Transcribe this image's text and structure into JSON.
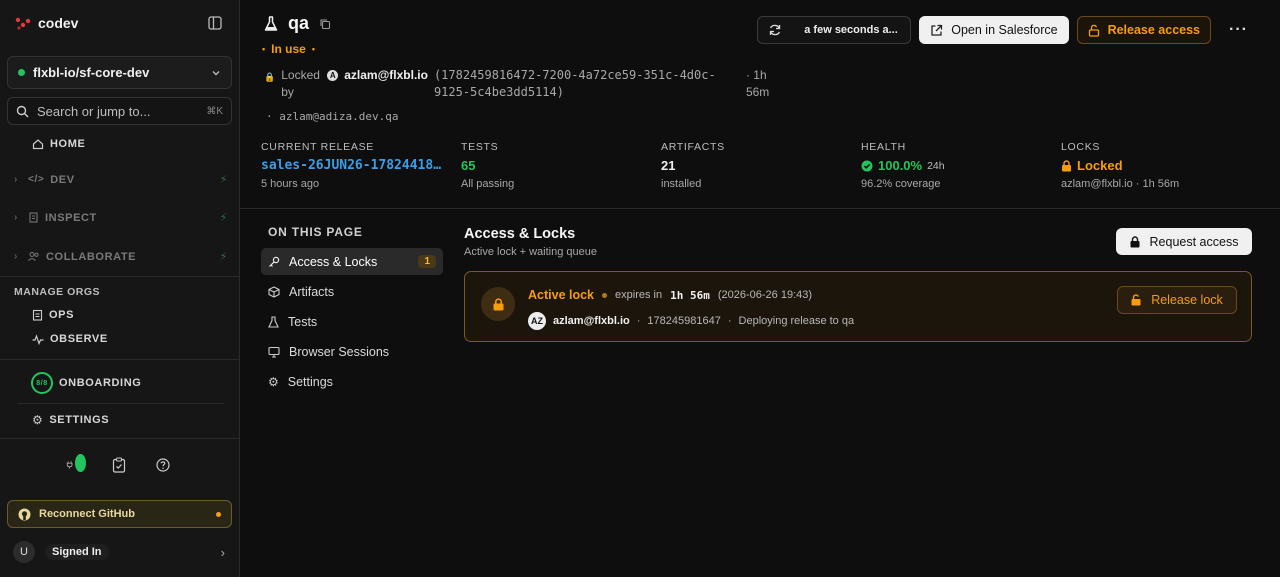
{
  "sidebar": {
    "brand": "codev",
    "org": "flxbl-io/sf-core-dev",
    "search_placeholder": "Search or jump to...",
    "search_shortcut": "⌘K",
    "nav": {
      "home": "HOME",
      "dev": "DEV",
      "inspect": "INSPECT",
      "collaborate": "COLLABORATE"
    },
    "manage_label": "MANAGE ORGS",
    "manage": {
      "ops": "OPS",
      "observe": "OBSERVE"
    },
    "onboarding": {
      "label": "ONBOARDING",
      "progress": "8/8"
    },
    "settings": "SETTINGS",
    "github_button": "Reconnect GitHub",
    "user": {
      "initial": "U",
      "status": "Signed In"
    }
  },
  "header": {
    "title": "qa",
    "status": "In use",
    "locked_by_label": "Locked by",
    "locked_by_initial": "A",
    "locked_by_user": "azlam@flxbl.io",
    "lock_id": "(1782459816472-7200-4a72ce59-351c-4d0c-9125-5c4be3dd5114)",
    "lock_duration": "· 1h 56m",
    "lock_email": "· azlam@adiza.dev.qa"
  },
  "actions": {
    "refresh_label": "a few seconds a...",
    "open_salesforce": "Open in Salesforce",
    "release_access": "Release access",
    "more": "···"
  },
  "stats": {
    "release": {
      "label": "CURRENT RELEASE",
      "value": "sales-26JUN26-17824418...",
      "sub": "5 hours ago"
    },
    "tests": {
      "label": "TESTS",
      "value": "65",
      "sub": "All passing"
    },
    "artifacts": {
      "label": "ARTIFACTS",
      "value": "21",
      "sub": "installed"
    },
    "health": {
      "label": "HEALTH",
      "value": "100.0%",
      "window": "24h",
      "sub": "96.2% coverage"
    },
    "locks": {
      "label": "LOCKS",
      "value": "Locked",
      "sub": "azlam@flxbl.io · 1h 56m"
    }
  },
  "toc": {
    "title": "ON THIS PAGE",
    "items": [
      {
        "label": "Access & Locks",
        "count": "1"
      },
      {
        "label": "Artifacts"
      },
      {
        "label": "Tests"
      },
      {
        "label": "Browser Sessions"
      },
      {
        "label": "Settings"
      }
    ]
  },
  "section": {
    "title": "Access & Locks",
    "subtitle": "Active lock + waiting queue",
    "request_button": "Request access"
  },
  "lock_card": {
    "status": "Active lock",
    "expires_label": "expires in",
    "expires_in": "1h 56m",
    "expires_at": "(2026-06-26 19:43)",
    "user_initials": "AZ",
    "user": "azlam@flxbl.io",
    "sep": "·",
    "id": "178245981647",
    "note": "Deploying release to qa",
    "release_button": "Release lock"
  },
  "colors": {
    "accent_green": "#22c55e",
    "warning": "#f59e0b",
    "link": "#3b9ee8"
  }
}
